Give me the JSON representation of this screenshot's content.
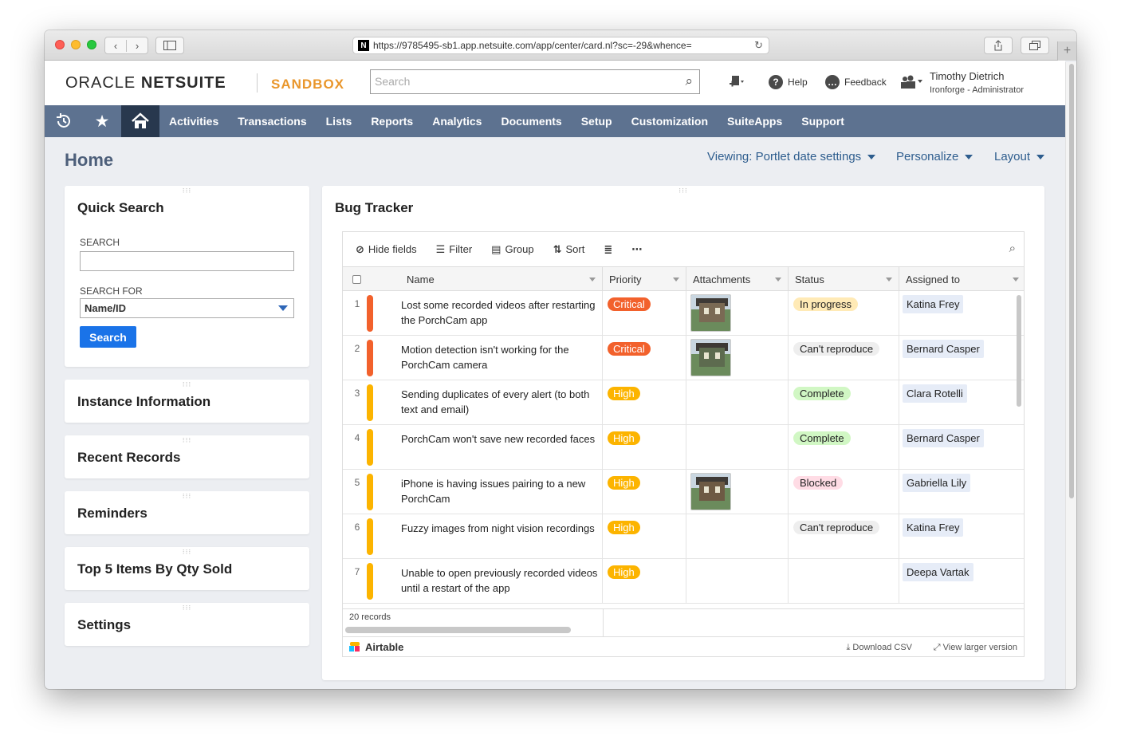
{
  "browser": {
    "url": "https://9785495-sb1.app.netsuite.com/app/center/card.nl?sc=-29&whence=",
    "favicon": "N"
  },
  "header": {
    "logo_left": "ORACLE",
    "logo_right": "NETSUITE",
    "env": "SANDBOX",
    "search_placeholder": "Search",
    "help": "Help",
    "feedback": "Feedback",
    "user_name": "Timothy Dietrich",
    "user_role": "Ironforge - Administrator"
  },
  "nav": {
    "items": [
      "Activities",
      "Transactions",
      "Lists",
      "Reports",
      "Analytics",
      "Documents",
      "Setup",
      "Customization",
      "SuiteApps",
      "Support"
    ]
  },
  "page": {
    "title": "Home",
    "viewing": "Viewing: Portlet date settings",
    "personalize": "Personalize",
    "layout": "Layout"
  },
  "quick_search": {
    "title": "Quick Search",
    "search_label": "SEARCH",
    "search_for_label": "SEARCH FOR",
    "search_for_value": "Name/ID",
    "button": "Search"
  },
  "portlets": {
    "instance": "Instance Information",
    "recent": "Recent Records",
    "reminders": "Reminders",
    "top5": "Top 5 Items By Qty Sold",
    "settings": "Settings"
  },
  "bug_tracker": {
    "title": "Bug Tracker",
    "toolbar": {
      "hide_fields": "Hide fields",
      "filter": "Filter",
      "group": "Group",
      "sort": "Sort"
    },
    "columns": {
      "name": "Name",
      "priority": "Priority",
      "attachments": "Attachments",
      "status": "Status",
      "assigned": "Assigned to"
    },
    "rows": [
      {
        "num": "1",
        "name": "Lost some recorded videos after restarting the PorchCam app",
        "priority": "Critical",
        "status": "In progress",
        "assigned": "Katina Frey"
      },
      {
        "num": "2",
        "name": "Motion detection isn't working for the PorchCam camera",
        "priority": "Critical",
        "status": "Can't reproduce",
        "assigned": "Bernard Casper"
      },
      {
        "num": "3",
        "name": "Sending duplicates of every alert (to both text and email)",
        "priority": "High",
        "status": "Complete",
        "assigned": "Clara Rotelli"
      },
      {
        "num": "4",
        "name": "PorchCam won't save new recorded faces",
        "priority": "High",
        "status": "Complete",
        "assigned": "Bernard Casper"
      },
      {
        "num": "5",
        "name": "iPhone is having issues pairing to a new PorchCam",
        "priority": "High",
        "status": "Blocked",
        "assigned": "Gabriella Lily"
      },
      {
        "num": "6",
        "name": "Fuzzy images from night vision recordings",
        "priority": "High",
        "status": "Can't reproduce",
        "assigned": "Katina Frey"
      },
      {
        "num": "7",
        "name": "Unable to open previously recorded videos until a restart of the app",
        "priority": "High",
        "status": "",
        "assigned": "Deepa Vartak"
      }
    ],
    "records": "20 records",
    "brand": "Airtable",
    "download": "Download CSV",
    "view_larger": "View larger version"
  },
  "colors": {
    "nav_bg": "#5d7290",
    "critical": "#f2612c",
    "high": "#fcb400",
    "search_btn": "#1a73e8"
  }
}
